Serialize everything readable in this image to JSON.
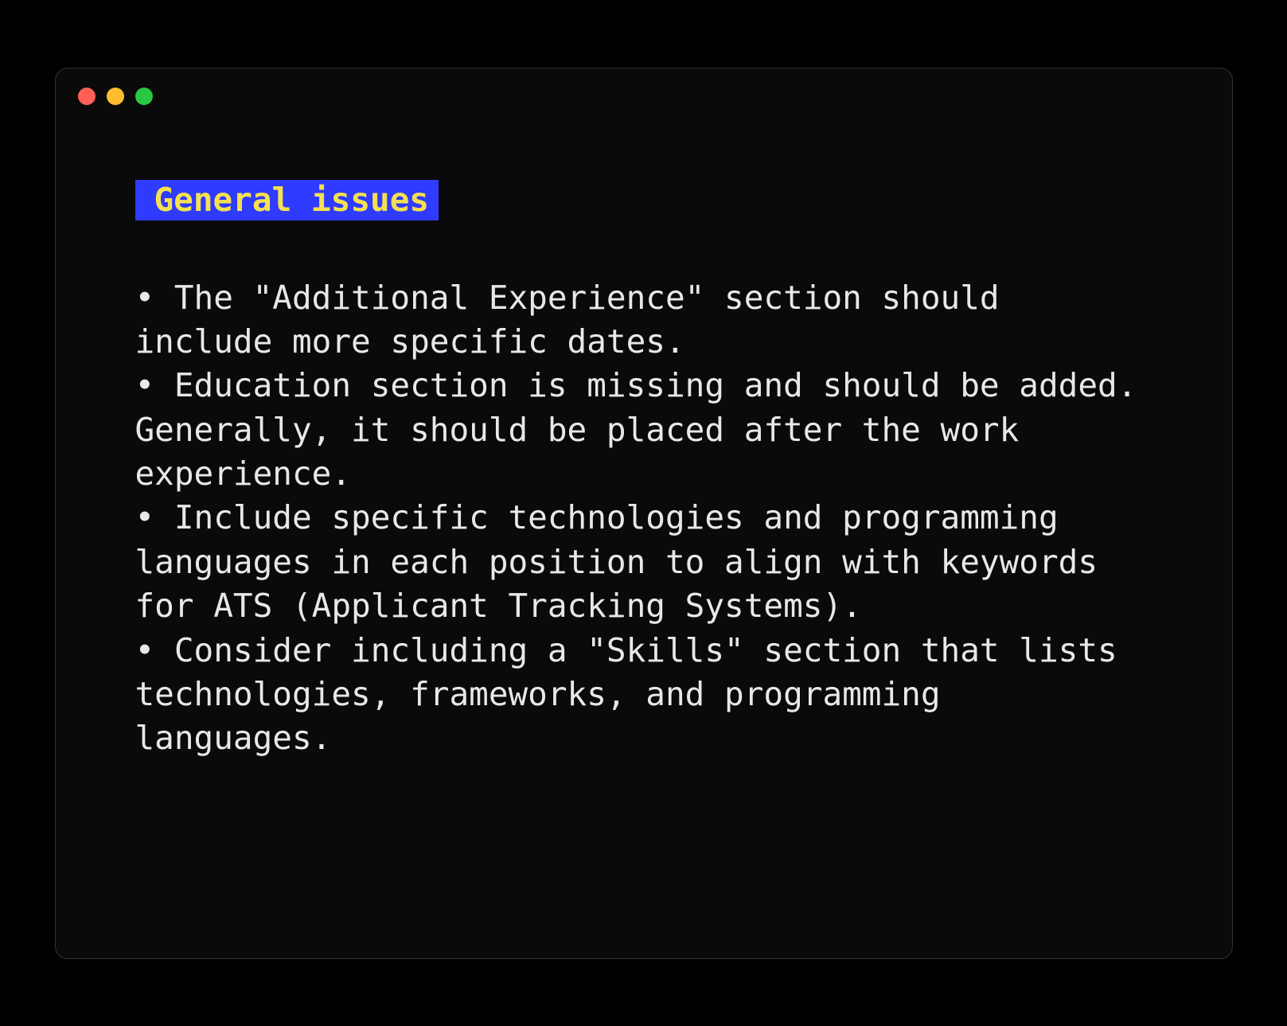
{
  "heading": "General issues",
  "bullets": [
    "• The \"Additional Experience\" section should include more specific dates.",
    "• Education section is missing and should be added. Generally, it should be placed after the work experience.",
    "• Include specific technologies and programming languages in each position to align with keywords for ATS (Applicant Tracking Systems).",
    "• Consider including a \"Skills\" section that lists technologies, frameworks, and programming languages."
  ],
  "colors": {
    "window_bg": "#0a0a0a",
    "page_bg": "#000000",
    "border": "#333333",
    "heading_bg": "#2f3bff",
    "heading_fg": "#f5e050",
    "text": "#e8e8e8",
    "traffic_red": "#ff5f57",
    "traffic_yellow": "#febc2e",
    "traffic_green": "#28c840"
  }
}
